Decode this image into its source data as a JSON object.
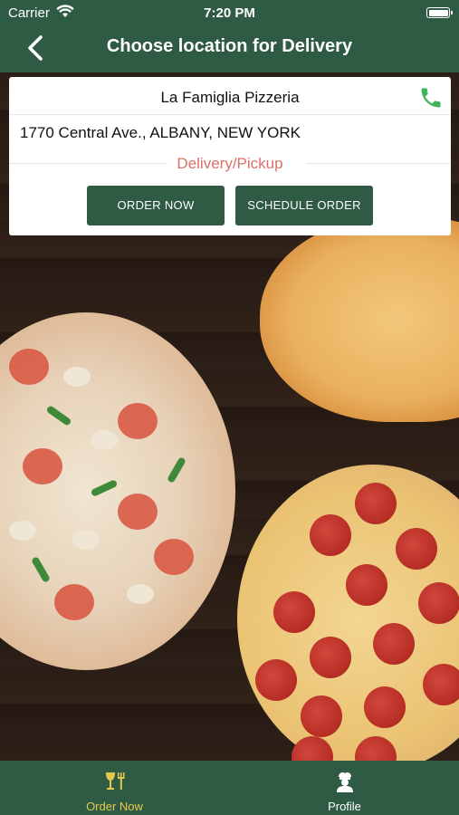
{
  "status_bar": {
    "carrier": "Carrier",
    "time": "7:20 PM"
  },
  "nav": {
    "title": "Choose location for Delivery"
  },
  "location_card": {
    "restaurant_name": "La Famiglia Pizzeria",
    "address": "1770 Central Ave., ALBANY, NEW YORK",
    "service_mode": "Delivery/Pickup",
    "order_now_label": "ORDER NOW",
    "schedule_order_label": "SCHEDULE ORDER"
  },
  "tab_bar": {
    "tabs": [
      {
        "label": "Order Now",
        "icon": "utensils-icon",
        "active": true
      },
      {
        "label": "Profile",
        "icon": "chef-profile-icon",
        "active": false
      }
    ]
  },
  "colors": {
    "brand_green": "#2f5a44",
    "phone_green": "#3fb55a",
    "service_mode_red": "#d9726a",
    "active_tab_yellow": "#e6c94a"
  }
}
